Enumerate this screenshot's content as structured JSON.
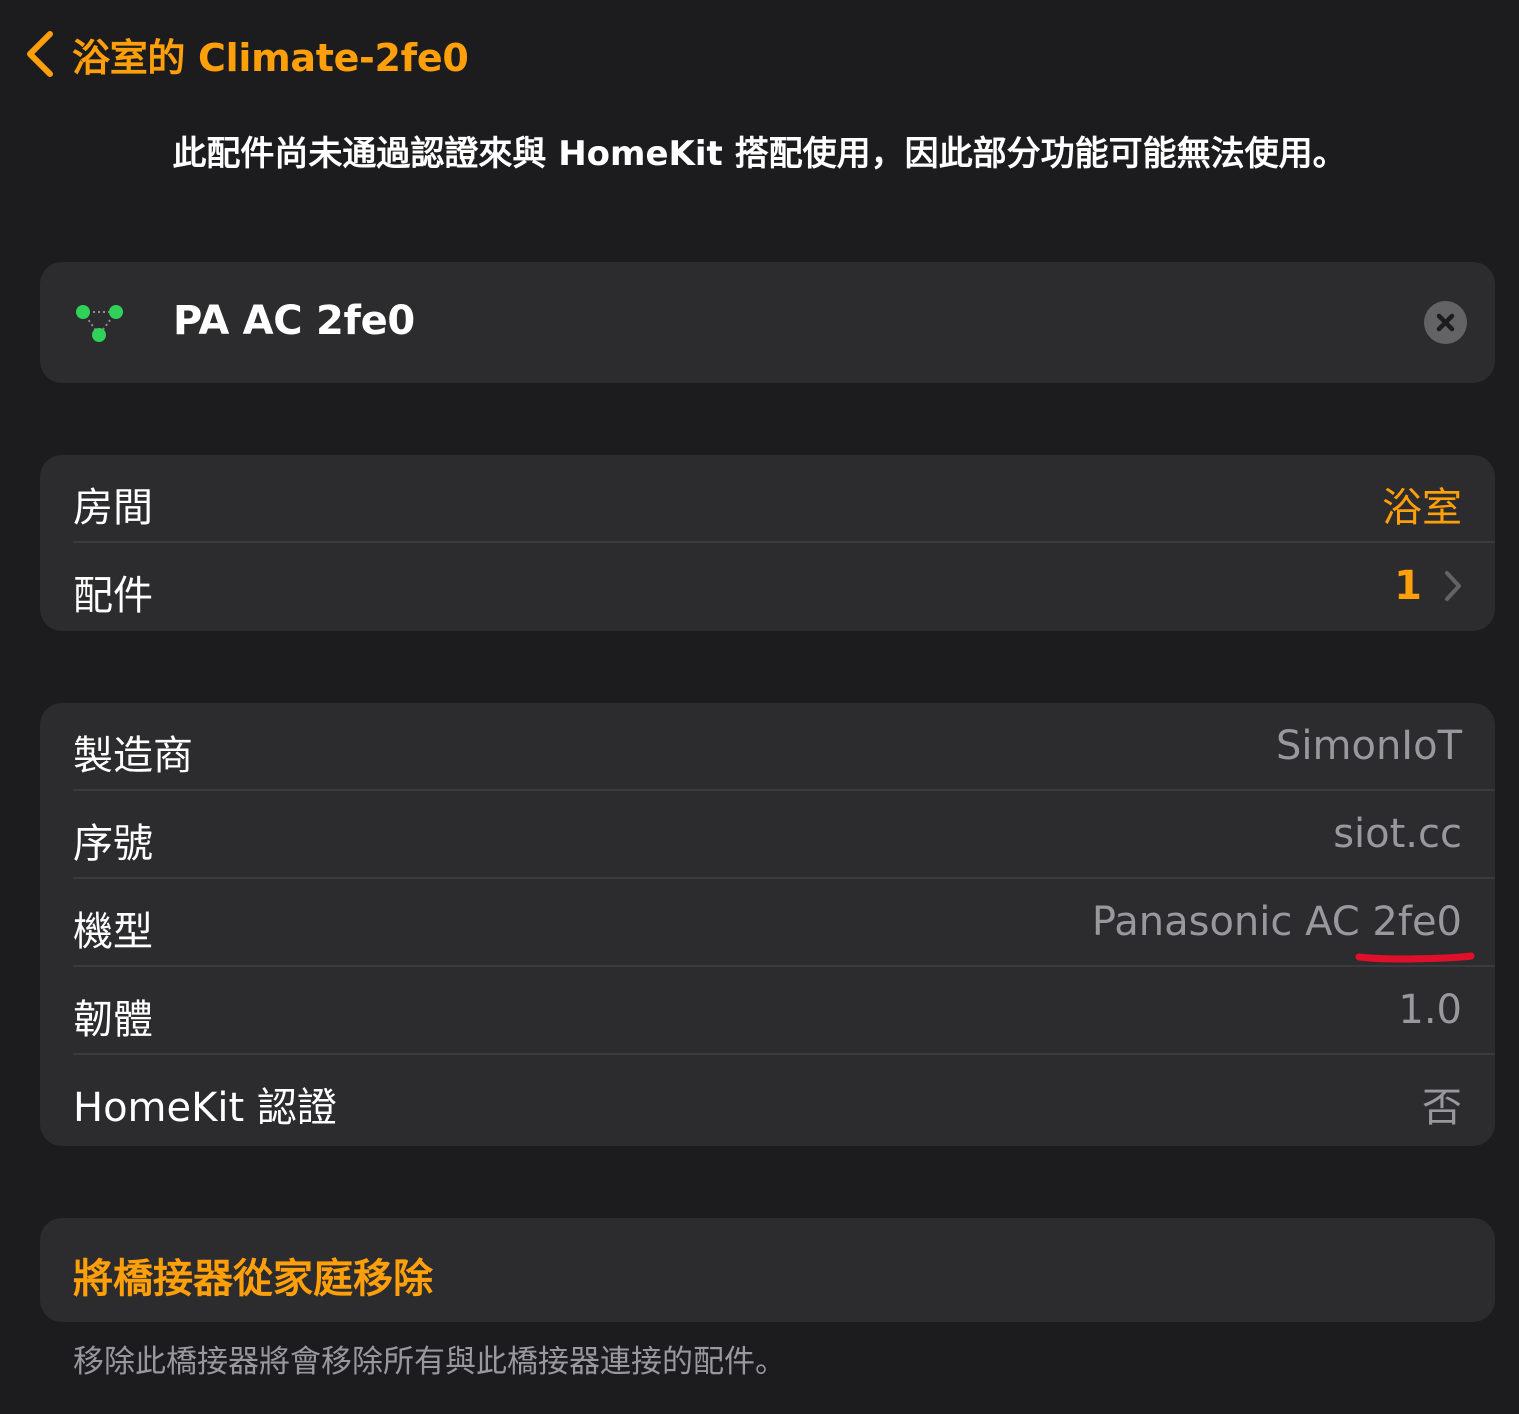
{
  "header": {
    "back_title": "浴室的 Climate-2fe0"
  },
  "notice": "此配件尚未通過認證來與 HomeKit 搭配使用，因此部分功能可能無法使用。",
  "bridge": {
    "name": "PA AC 2fe0",
    "icon_color": "#30d158"
  },
  "room_section": {
    "room_label": "房間",
    "room_value": "浴室",
    "accessories_label": "配件",
    "accessories_value": "1"
  },
  "info_section": {
    "rows": [
      {
        "label": "製造商",
        "value": "SimonIoT"
      },
      {
        "label": "序號",
        "value": "siot.cc"
      },
      {
        "label": "機型",
        "value": "Panasonic AC 2fe0"
      },
      {
        "label": "韌體",
        "value": "1.0"
      },
      {
        "label": "HomeKit 認證",
        "value": "否"
      }
    ]
  },
  "remove": {
    "label": "將橋接器從家庭移除",
    "note": "移除此橋接器將會移除所有與此橋接器連接的配件。"
  },
  "colors": {
    "accent": "#ff9f0a",
    "background": "#1c1c1e",
    "card": "#2c2c2e",
    "secondary_text": "#98989d",
    "annotation": "#e0102a"
  }
}
